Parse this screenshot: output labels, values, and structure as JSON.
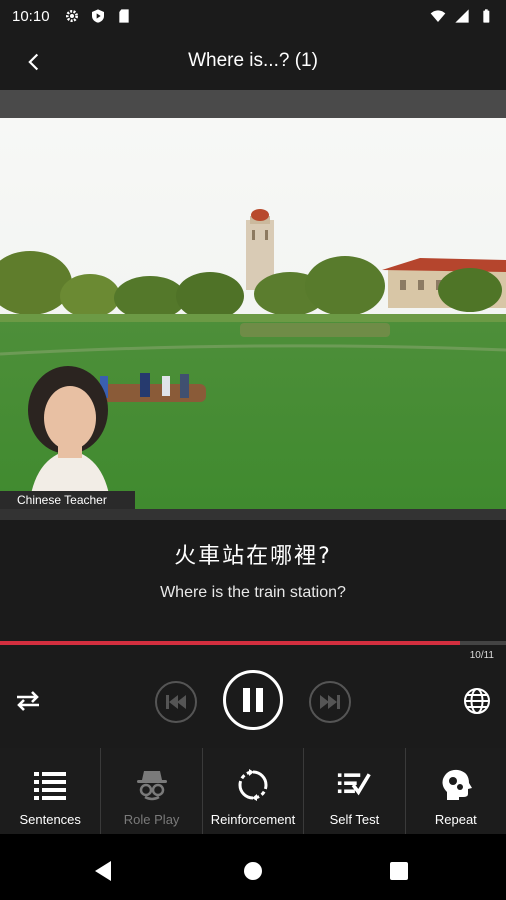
{
  "status_bar": {
    "time": "10:10"
  },
  "header": {
    "title": "Where is...? (1)"
  },
  "video": {
    "speaker_label": "Chinese Teacher"
  },
  "sentence": {
    "chinese": "火車站在哪裡?",
    "english": "Where is the train station?"
  },
  "progress": {
    "current": 10,
    "total": 11,
    "counter_text": "10/11",
    "fraction": 0.91
  },
  "colors": {
    "accent": "#d32f3f",
    "background": "#1b1b1b"
  },
  "controls": {
    "repeat_icon": "repeat-icon",
    "previous_icon": "skip-previous-icon",
    "pause_icon": "pause-icon",
    "next_icon": "skip-next-icon",
    "language_icon": "globe-icon"
  },
  "tabs": [
    {
      "label": "Sentences",
      "icon": "list-icon",
      "enabled": true
    },
    {
      "label": "Role Play",
      "icon": "spy-icon",
      "enabled": false
    },
    {
      "label": "Reinforcement",
      "icon": "cycle-icon",
      "enabled": true
    },
    {
      "label": "Self Test",
      "icon": "checklist-icon",
      "enabled": true
    },
    {
      "label": "Repeat",
      "icon": "head-gears-icon",
      "enabled": true
    }
  ]
}
